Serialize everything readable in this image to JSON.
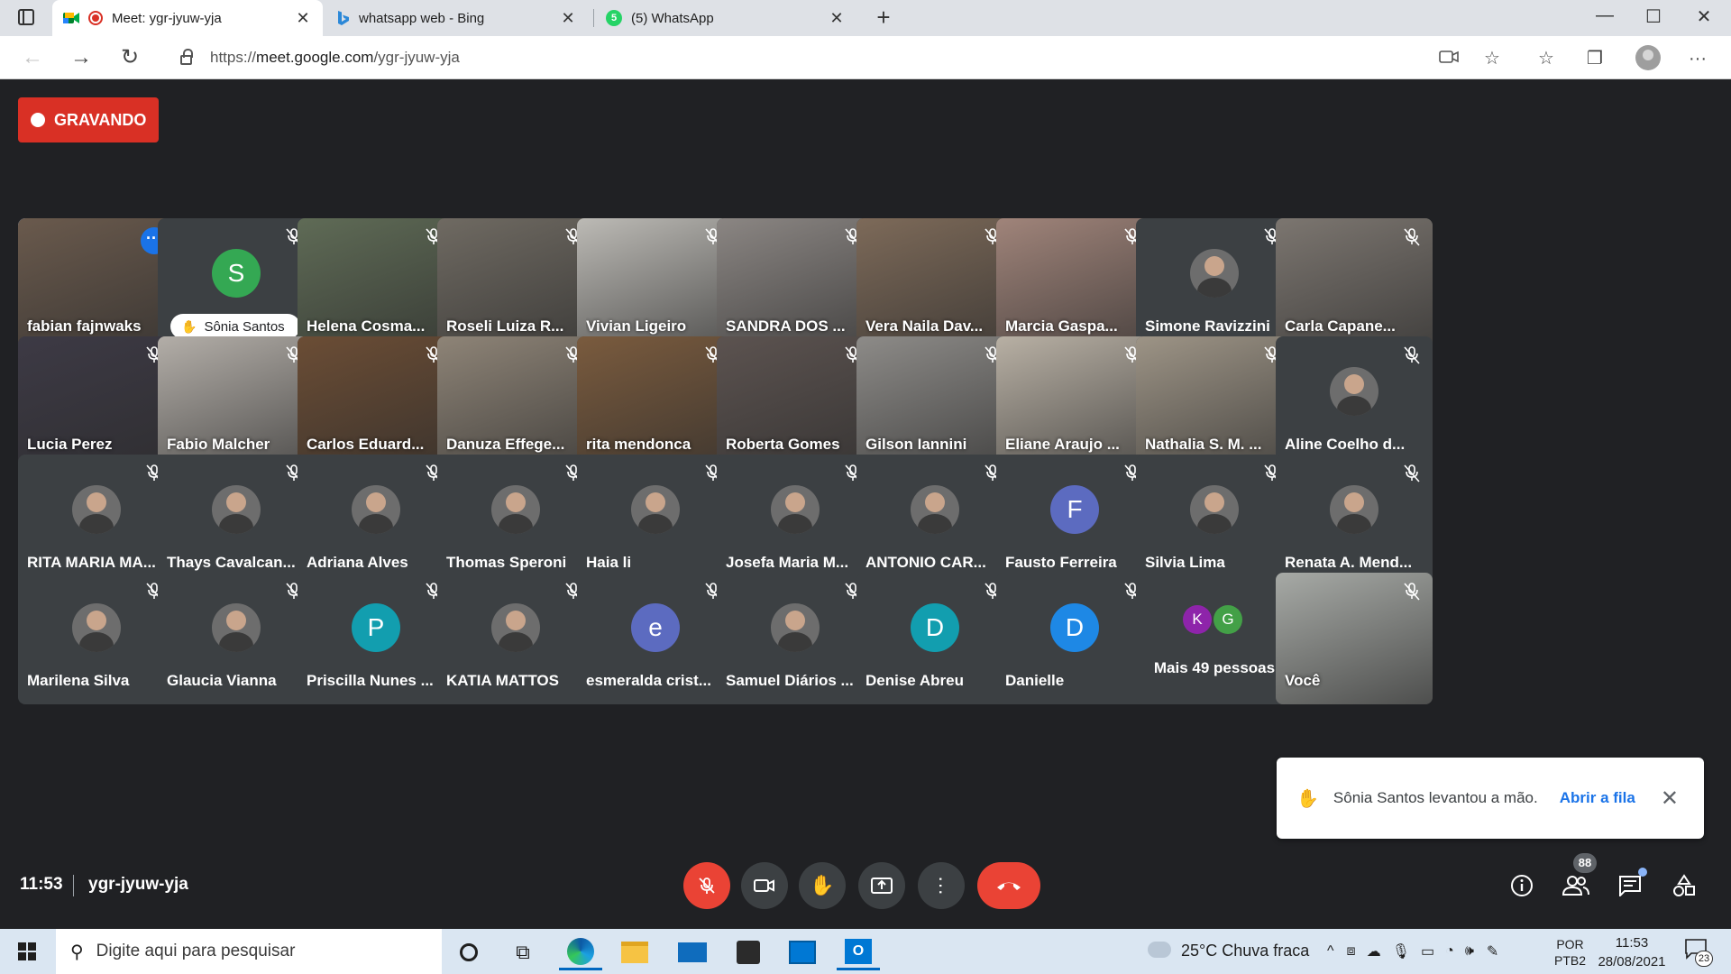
{
  "browser": {
    "tabs": [
      {
        "title": "Meet: ygr-jyuw-yja",
        "close": "✕",
        "active": true
      },
      {
        "title": "whatsapp web - Bing",
        "close": "✕",
        "active": false
      },
      {
        "title": "(5) WhatsApp",
        "close": "✕",
        "active": false
      }
    ],
    "new_tab": "+",
    "url_scheme": "https://",
    "url_host": "meet.google.com",
    "url_path": "/ygr-jyuw-yja",
    "window": {
      "minimize": "—",
      "maximize": "☐",
      "close": "✕"
    }
  },
  "meet": {
    "recording_label": "GRAVANDO",
    "clock": "11:53",
    "meeting_code": "ygr-jyuw-yja",
    "people_count": "88",
    "tiles": [
      {
        "name": "fabian fajnwaks",
        "kind": "video",
        "bg": "#6a5a4d",
        "speaker": true
      },
      {
        "name": "Sônia Santos",
        "kind": "letter",
        "letter": "S",
        "color": "#34a853",
        "hand": true
      },
      {
        "name": "Helena Cosma...",
        "kind": "video",
        "bg": "#5f6b56"
      },
      {
        "name": "Roseli Luiza R...",
        "kind": "video",
        "bg": "#6f6a62"
      },
      {
        "name": "Vivian Ligeiro",
        "kind": "video",
        "bg": "#bcbab5"
      },
      {
        "name": "SANDRA DOS ...",
        "kind": "video",
        "bg": "#8b8683"
      },
      {
        "name": "Vera Naila Dav...",
        "kind": "video",
        "bg": "#7d6a59"
      },
      {
        "name": "Marcia Gaspa...",
        "kind": "video",
        "bg": "#a0847a"
      },
      {
        "name": "Simone Ravizzini",
        "kind": "photo"
      },
      {
        "name": "Carla Capane...",
        "kind": "video",
        "bg": "#7c7670"
      },
      {
        "name": "Lucia Perez",
        "kind": "video",
        "bg": "#3d3a45"
      },
      {
        "name": "Fabio Malcher",
        "kind": "video",
        "bg": "#b3aea8"
      },
      {
        "name": "Carlos Eduard...",
        "kind": "video",
        "bg": "#6b4d35"
      },
      {
        "name": "Danuza Effege...",
        "kind": "video",
        "bg": "#8e8477"
      },
      {
        "name": "rita mendonca",
        "kind": "video",
        "bg": "#7a5b3e"
      },
      {
        "name": "Roberta Gomes",
        "kind": "video",
        "bg": "#5c5350"
      },
      {
        "name": "Gilson Iannini",
        "kind": "video",
        "bg": "#8d8b88"
      },
      {
        "name": "Eliane Araujo ...",
        "kind": "video",
        "bg": "#b8b0a4"
      },
      {
        "name": "Nathalia S. M. ...",
        "kind": "video",
        "bg": "#9d9486"
      },
      {
        "name": "Aline Coelho d...",
        "kind": "photo"
      },
      {
        "name": "RITA MARIA MA...",
        "kind": "photo"
      },
      {
        "name": "Thays Cavalcan...",
        "kind": "photo"
      },
      {
        "name": "Adriana Alves",
        "kind": "photo"
      },
      {
        "name": "Thomas Speroni",
        "kind": "photo"
      },
      {
        "name": "Haia li",
        "kind": "photo"
      },
      {
        "name": "Josefa Maria M...",
        "kind": "photo"
      },
      {
        "name": "ANTONIO CAR...",
        "kind": "photo"
      },
      {
        "name": "Fausto Ferreira",
        "kind": "letter",
        "letter": "F",
        "color": "#5c6bc0"
      },
      {
        "name": "Silvia Lima",
        "kind": "photo"
      },
      {
        "name": "Renata A. Mend...",
        "kind": "photo"
      },
      {
        "name": "Marilena Silva",
        "kind": "photo"
      },
      {
        "name": "Glaucia Vianna",
        "kind": "photo"
      },
      {
        "name": "Priscilla Nunes ...",
        "kind": "letter",
        "letter": "P",
        "color": "#129eaf"
      },
      {
        "name": "KATIA MATTOS",
        "kind": "photo"
      },
      {
        "name": "esmeralda crist...",
        "kind": "letter",
        "letter": "e",
        "color": "#5c6bc0"
      },
      {
        "name": "Samuel Diários ...",
        "kind": "photo"
      },
      {
        "name": "Denise Abreu",
        "kind": "letter",
        "letter": "D",
        "color": "#129eaf"
      },
      {
        "name": "Danielle",
        "kind": "letter",
        "letter": "D",
        "color": "#1e88e5"
      },
      {
        "name": "Mais 49 pessoas",
        "kind": "more",
        "a": "K",
        "b": "G"
      },
      {
        "name": "Você",
        "kind": "video",
        "bg": "#a7aaa6"
      }
    ],
    "toast": {
      "message": "Sônia Santos levantou a mão.",
      "action": "Abrir a fila",
      "close": "✕"
    },
    "colors": {
      "recording": "#d93025",
      "leave": "#ea4335",
      "accent": "#1a73e8",
      "speaker_outline": "#8ab4f8"
    }
  },
  "taskbar": {
    "search_placeholder": "Digite aqui para pesquisar",
    "weather": "25°C  Chuva fraca",
    "lang_1": "POR",
    "lang_2": "PTB2",
    "time": "11:53",
    "date": "28/08/2021",
    "notifications": "23"
  }
}
